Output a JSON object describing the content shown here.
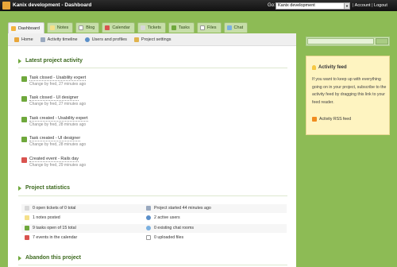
{
  "window": {
    "title": "Kanix development - Dashboard",
    "go_label": "Go:",
    "project_selector": "Kanix development",
    "links": {
      "account": "Account",
      "logout": "Logout"
    }
  },
  "tabs": [
    {
      "label": "Dashboard",
      "icon": "dashboard-icon",
      "active": true
    },
    {
      "label": "Notes",
      "icon": "notes-icon"
    },
    {
      "label": "Blog",
      "icon": "blog-icon"
    },
    {
      "label": "Calendar",
      "icon": "calendar-icon"
    },
    {
      "label": "Tickets",
      "icon": "tickets-icon"
    },
    {
      "label": "Tasks",
      "icon": "tasks-icon"
    },
    {
      "label": "Files",
      "icon": "files-icon"
    },
    {
      "label": "Chat",
      "icon": "chat-icon"
    }
  ],
  "subnav": [
    {
      "label": "Home",
      "icon": "home-icon"
    },
    {
      "label": "Activity timeline",
      "icon": "timeline-icon"
    },
    {
      "label": "Users and profiles",
      "icon": "users-icon"
    },
    {
      "label": "Project settings",
      "icon": "settings-icon"
    }
  ],
  "activity": {
    "title": "Latest project activity",
    "items": [
      {
        "title": "Task closed - Usability expert",
        "meta": "Change by fred, 27 minutes ago",
        "icon": "task-icon"
      },
      {
        "title": "Task closed - UI designer",
        "meta": "Change by fred, 27 minutes ago",
        "icon": "task-icon"
      },
      {
        "title": "Task created - Usability expert",
        "meta": "Change by fred, 28 minutes ago",
        "icon": "task-icon"
      },
      {
        "title": "Task created - UI designer",
        "meta": "Change by fred, 28 minutes ago",
        "icon": "task-icon"
      },
      {
        "title": "Created event - Rails day",
        "meta": "Change by fred, 29 minutes ago",
        "icon": "calendar-icon"
      }
    ]
  },
  "statistics": {
    "title": "Project statistics",
    "left": [
      {
        "text": "0 open tickets of 0 total",
        "icon": "ticket-icon"
      },
      {
        "text": "1 notes posted",
        "icon": "note-icon"
      },
      {
        "text": "9 tasks open of 15 total",
        "icon": "task-icon"
      },
      {
        "text": "7 events in the calendar",
        "icon": "calendar-icon"
      }
    ],
    "right": [
      {
        "text": "Project started 44 minutes ago",
        "icon": "clock-icon"
      },
      {
        "text": "2 active users",
        "icon": "user-icon"
      },
      {
        "text": "0 existing chat rooms",
        "icon": "chat-icon"
      },
      {
        "text": "0 uploaded files",
        "icon": "file-icon"
      }
    ]
  },
  "abandon": {
    "title": "Abandon this project"
  },
  "sidebar": {
    "feed": {
      "title": "Activity feed",
      "text": "If you want to keep up with everything going on in your project, subscribe to the activity feed by dragging this link to your feed reader.",
      "link": "Activity RSS feed"
    }
  },
  "colors": {
    "background": "#8dbb55",
    "heading": "#3d6a1f",
    "feed_box": "#fef4c1"
  }
}
